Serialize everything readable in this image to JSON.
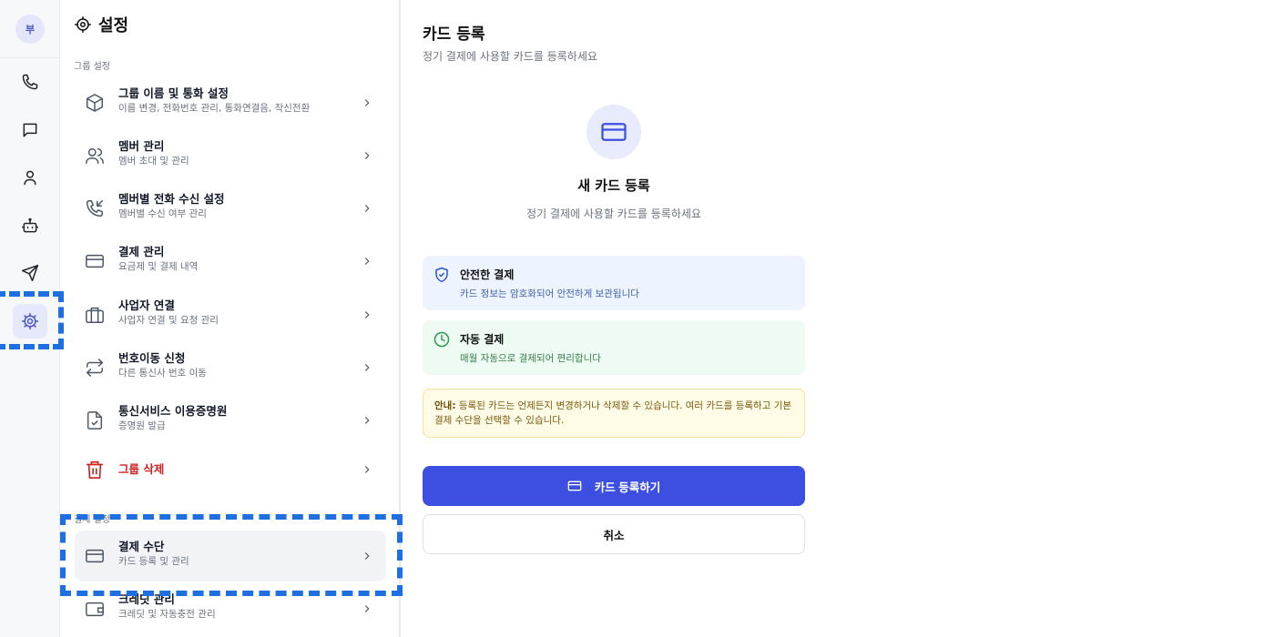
{
  "rail": {
    "avatar": "부",
    "items": [
      {
        "icon": "phone-icon"
      },
      {
        "icon": "chat-icon"
      },
      {
        "icon": "user-icon"
      },
      {
        "icon": "bot-icon"
      },
      {
        "icon": "send-icon"
      },
      {
        "icon": "gear-icon",
        "active": true
      }
    ]
  },
  "settings": {
    "title": "설정",
    "group_section_label": "그룹 설정",
    "payment_section_label": "결제 설정",
    "items": [
      {
        "label": "그룹 이름 및 통화 설정",
        "desc": "이름 변경, 전화번호 관리, 통화연결음, 착신전환",
        "icon": "cube-icon"
      },
      {
        "label": "멤버 관리",
        "desc": "멤버 초대 및 관리",
        "icon": "users-icon"
      },
      {
        "label": "멤버별 전화 수신 설정",
        "desc": "멤버별 수신 여부 관리",
        "icon": "phone-incoming-icon"
      },
      {
        "label": "결제 관리",
        "desc": "요금제 및 결제 내역",
        "icon": "credit-card-icon"
      },
      {
        "label": "사업자 연결",
        "desc": "사업자 연결 및 요청 관리",
        "icon": "briefcase-icon"
      },
      {
        "label": "번호이동 신청",
        "desc": "다른 통신사 번호 이동",
        "icon": "transfer-icon"
      },
      {
        "label": "통신서비스 이용증명원",
        "desc": "증명원 발급",
        "icon": "document-check-icon"
      },
      {
        "label": "그룹 삭제",
        "desc": "",
        "icon": "trash-icon"
      }
    ],
    "payment_items": [
      {
        "label": "결제 수단",
        "desc": "카드 등록 및 관리",
        "icon": "credit-card-icon",
        "selected": true
      },
      {
        "label": "크레딧 관리",
        "desc": "크레딧 및 자동충전 관리",
        "icon": "wallet-icon"
      }
    ]
  },
  "content": {
    "title": "카드 등록",
    "subtitle": "정기 결제에 사용할 카드를 등록하세요",
    "hero_title": "새 카드 등록",
    "hero_subtitle": "정기 결제에 사용할 카드를 등록하세요",
    "secure_title": "안전한 결제",
    "secure_desc": "카드 정보는 암호화되어 안전하게 보관됩니다",
    "auto_title": "자동 결제",
    "auto_desc": "매월 자동으로 결제되어 편리합니다",
    "notice_label": "안내:",
    "notice_text": " 등록된 카드는 언제든지 변경하거나 삭제할 수 있습니다. 여러 카드를 등록하고 기본 결제 수단을 선택할 수 있습니다.",
    "register_button": "카드 등록하기",
    "cancel_button": "취소"
  },
  "colors": {
    "accent": "#3c4fe0",
    "danger": "#d42020",
    "highlight": "#1e6fe0"
  }
}
